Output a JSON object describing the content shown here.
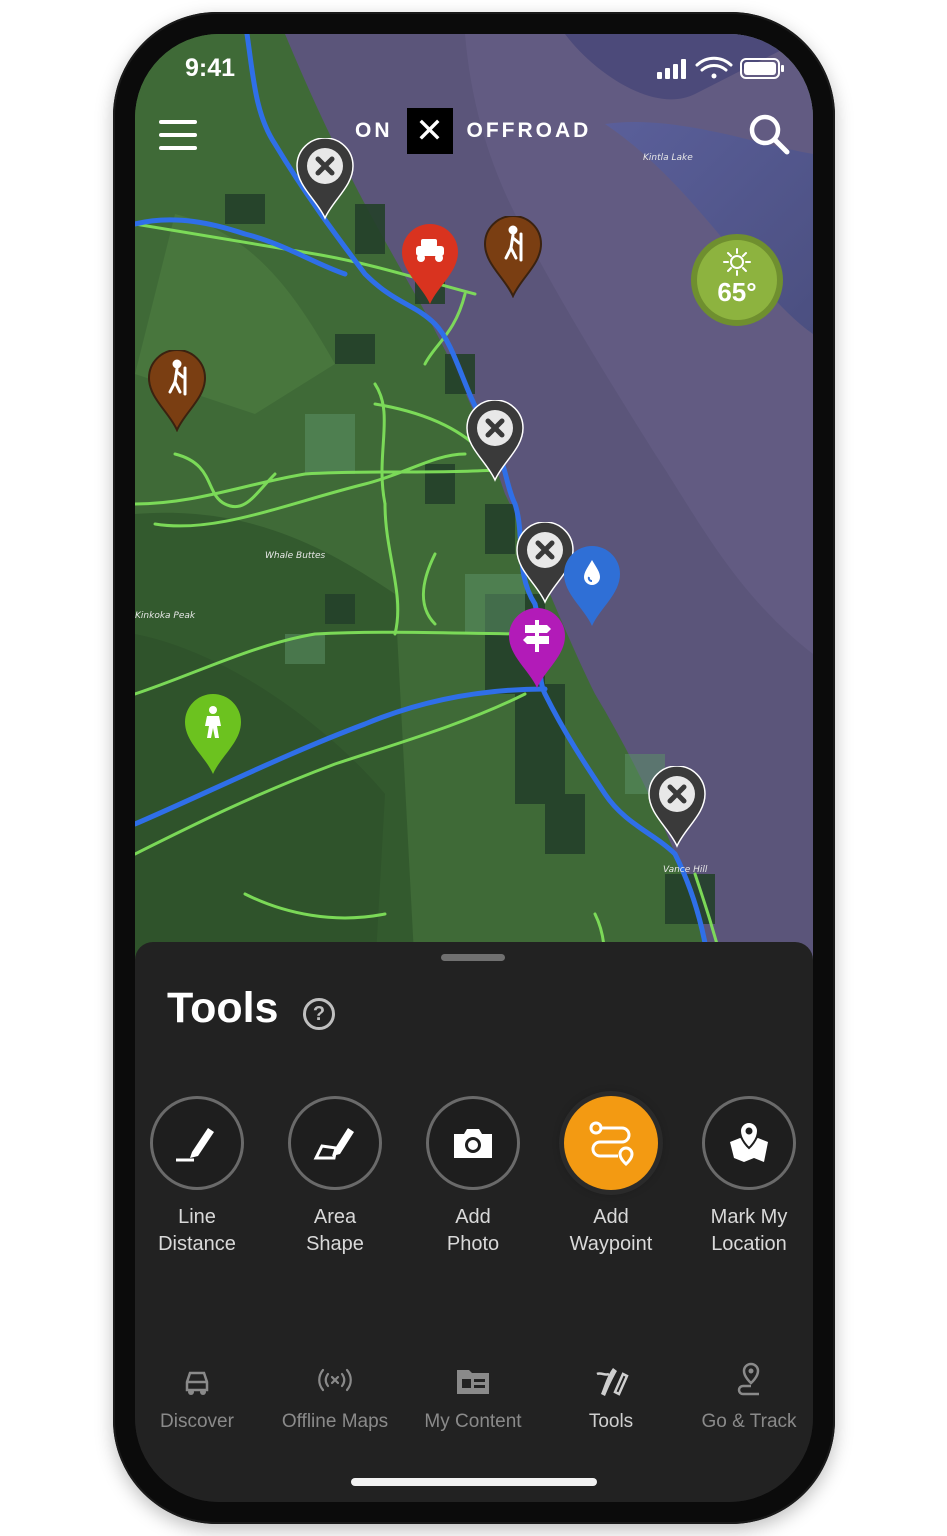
{
  "status": {
    "time": "9:41"
  },
  "header": {
    "brand_left": "ON",
    "brand_x": "✕",
    "brand_right": "OFFROAD"
  },
  "weather": {
    "temperature": "65°",
    "icon": "sun-icon"
  },
  "map_labels": {
    "place1": "Whale Buttes",
    "place2": "Kinkoka Peak",
    "place3": "Vance Hill",
    "place4": "Kintla Lake"
  },
  "pins": [
    {
      "type": "closed-x",
      "color": "#3a3a3a"
    },
    {
      "type": "vehicle",
      "color": "#d9331f"
    },
    {
      "type": "hiker",
      "color": "#7a3e12"
    },
    {
      "type": "hiker",
      "color": "#7a3e12"
    },
    {
      "type": "closed-x",
      "color": "#3a3a3a"
    },
    {
      "type": "closed-x",
      "color": "#3a3a3a"
    },
    {
      "type": "water",
      "color": "#2f6fd6"
    },
    {
      "type": "signpost",
      "color": "#b21bb8"
    },
    {
      "type": "bigfoot",
      "color": "#6cc21f"
    },
    {
      "type": "closed-x",
      "color": "#3a3a3a"
    }
  ],
  "tools": {
    "title": "Tools",
    "help": "?",
    "items": [
      {
        "line1": "Line",
        "line2": "Distance",
        "icon": "pencil-line-icon"
      },
      {
        "line1": "Area",
        "line2": "Shape",
        "icon": "pencil-shape-icon"
      },
      {
        "line1": "Add",
        "line2": "Photo",
        "icon": "camera-icon"
      },
      {
        "line1": "Add",
        "line2": "Waypoint",
        "icon": "route-icon",
        "active": true
      },
      {
        "line1": "Mark My",
        "line2": "Location",
        "icon": "location-map-icon"
      }
    ]
  },
  "nav": [
    {
      "label": "Discover",
      "icon": "vehicle-icon"
    },
    {
      "label": "Offline Maps",
      "icon": "broadcast-icon"
    },
    {
      "label": "My Content",
      "icon": "folder-icon"
    },
    {
      "label": "Tools",
      "icon": "tools-icon",
      "active": true
    },
    {
      "label": "Go & Track",
      "icon": "track-icon"
    }
  ],
  "colors": {
    "accent": "#f39a12",
    "sheet": "#222222",
    "trail": "#7fe05a",
    "road": "#2f6fe8"
  }
}
